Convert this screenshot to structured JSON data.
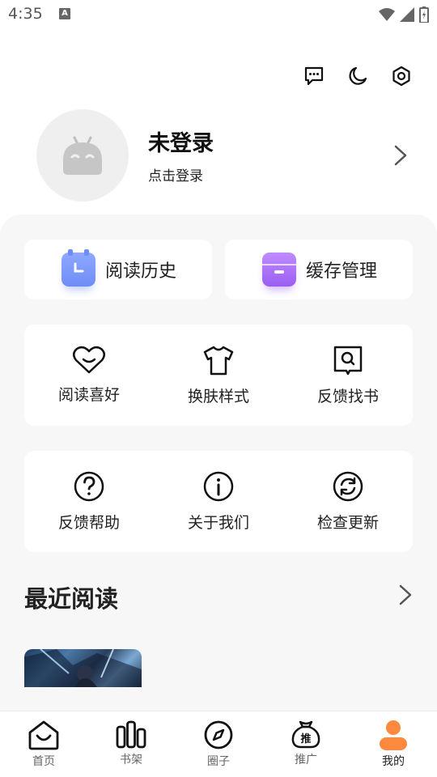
{
  "status": {
    "time": "4:35",
    "a_badge": "A"
  },
  "top_icons": [
    "message-icon",
    "moon-icon",
    "settings-icon"
  ],
  "profile": {
    "name": "未登录",
    "subtitle": "点击登录"
  },
  "quick": [
    {
      "label": "阅读历史",
      "icon": "clock-icon",
      "color": "#6e8cf5"
    },
    {
      "label": "缓存管理",
      "icon": "cache-icon",
      "color": "#a56ef5"
    }
  ],
  "grid1": [
    {
      "label": "阅读喜好",
      "icon": "heart-icon"
    },
    {
      "label": "换肤样式",
      "icon": "shirt-icon"
    },
    {
      "label": "反馈找书",
      "icon": "book-search-icon"
    }
  ],
  "grid2": [
    {
      "label": "反馈帮助",
      "icon": "help-icon"
    },
    {
      "label": "关于我们",
      "icon": "info-icon"
    },
    {
      "label": "检查更新",
      "icon": "refresh-icon"
    }
  ],
  "recent": {
    "title": "最近阅读"
  },
  "tabs": [
    {
      "label": "首页",
      "icon": "home-icon"
    },
    {
      "label": "书架",
      "icon": "bookshelf-icon"
    },
    {
      "label": "圈子",
      "icon": "compass-icon"
    },
    {
      "label": "推广",
      "icon": "promo-bag-icon",
      "glyph": "推"
    },
    {
      "label": "我的",
      "icon": "user-icon",
      "active": true
    }
  ],
  "colors": {
    "accent": "#ff8a3d",
    "panel": "#f7f7f7"
  }
}
